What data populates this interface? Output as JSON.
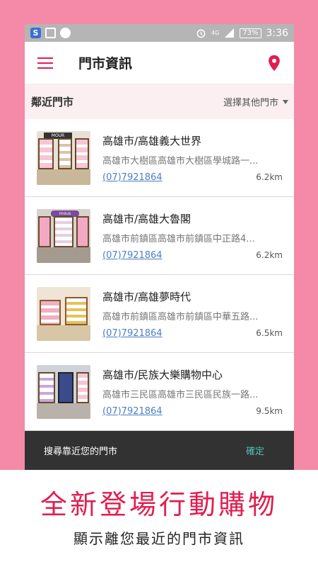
{
  "statusbar": {
    "left_icons": [
      "app-s-icon",
      "image-icon",
      "messenger-icon"
    ],
    "right_icons": [
      "alarm-icon",
      "signal-icon"
    ],
    "network": "4G",
    "battery": "73%",
    "time": "3:36"
  },
  "appbar": {
    "title": "門市資訊",
    "menu_icon": "hamburger-menu-icon",
    "location_icon": "map-pin-icon",
    "accent": "#e01e4f"
  },
  "subheader": {
    "label": "鄰近門市",
    "select_label": "選擇其他門市"
  },
  "stores": [
    {
      "name": "高雄市/高雄義大世界",
      "address": "高雄市大樹區高雄市大樹區學城路一...",
      "phone": "(07)7921864",
      "distance": "6.2km"
    },
    {
      "name": "高雄市/高雄大魯閣",
      "address": "高雄市前鎮區高雄市前鎮區中正路4...",
      "phone": "(07)7921864",
      "distance": "6.2km"
    },
    {
      "name": "高雄市/高雄夢時代",
      "address": "高雄市前鎮區高雄市前鎮區中華五路...",
      "phone": "(07)7921864",
      "distance": "6.5km"
    },
    {
      "name": "高雄市/民族大樂購物中心",
      "address": "高雄市三民區高雄市三民區民族一路...",
      "phone": "(07)7921864",
      "distance": "9.5km"
    }
  ],
  "snackbar": {
    "message": "搜尋靠近您的門市",
    "action": "確定"
  },
  "promo": {
    "title": "全新登場行動購物",
    "subtitle": "顯示離您最近的門市資訊"
  },
  "colors": {
    "background_pink": "#f48aa7",
    "brand_red": "#e01e4f",
    "link_blue": "#4a7fc4",
    "snackbar_action": "#4fc3b5"
  }
}
